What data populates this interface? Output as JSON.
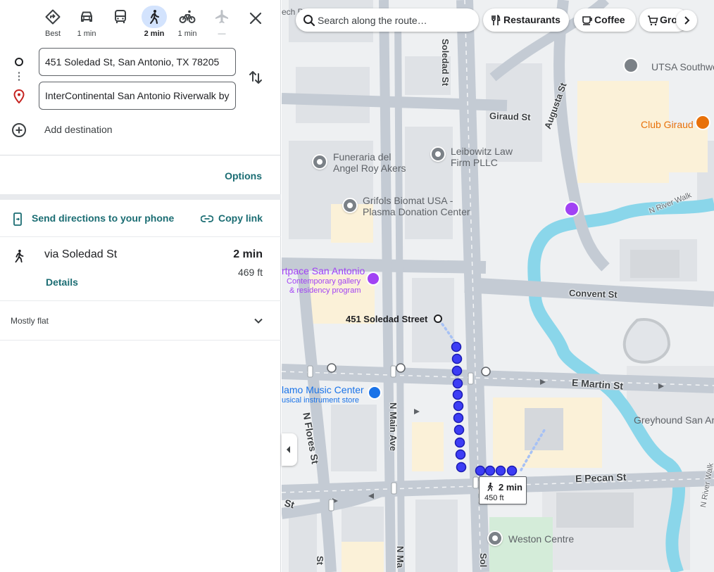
{
  "travel_modes": [
    {
      "id": "best",
      "label": "Best",
      "active": false,
      "disabled": false
    },
    {
      "id": "driving",
      "label": "1 min",
      "active": false,
      "disabled": false
    },
    {
      "id": "transit",
      "label": "",
      "active": false,
      "disabled": false
    },
    {
      "id": "walking",
      "label": "2 min",
      "active": true,
      "disabled": false
    },
    {
      "id": "cycling",
      "label": "1 min",
      "active": false,
      "disabled": false
    },
    {
      "id": "flight",
      "label": "—",
      "active": false,
      "disabled": true
    }
  ],
  "origin": {
    "value": "451 Soledad St, San Antonio, TX 78205"
  },
  "destination": {
    "value": "InterContinental San Antonio Riverwalk by IHG"
  },
  "add_destination_label": "Add destination",
  "options_label": "Options",
  "send_to_phone_label": "Send directions to your phone",
  "copy_link_label": "Copy link",
  "route": {
    "via": "via Soledad St",
    "duration": "2 min",
    "distance": "469 ft",
    "details_label": "Details",
    "elevation": "Mostly flat"
  },
  "map": {
    "search_placeholder": "Search along the route…",
    "chips": [
      {
        "id": "restaurants",
        "label": "Restaurants"
      },
      {
        "id": "coffee",
        "label": "Coffee"
      },
      {
        "id": "groceries",
        "label": "Gro"
      }
    ],
    "places": {
      "utsa": "UTSA Southwes",
      "club_giraud": "Club Giraud",
      "funeraria_1": "Funeraria del",
      "funeraria_2": "Angel Roy Akers",
      "leibowitz_1": "Leibowitz Law",
      "leibowitz_2": "Firm PLLC",
      "grifols_1": "Grifols Biomat USA -",
      "grifols_2": "Plasma Donation Center",
      "artpace_1": "rtpace San Antonio",
      "artpace_2": "Contemporary gallery",
      "artpace_3": "& residency program",
      "origin_label": "451 Soledad Street",
      "alamo_1": "lamo Music Center",
      "alamo_2": "usical instrument store",
      "greyhound": "Greyhound San An",
      "weston": "Weston Centre",
      "tech": "ech P"
    },
    "streets": {
      "soledad_top": "Soledad St",
      "soledad_bottom": "Sol",
      "giraud": "Giraud St",
      "augusta": "Augusta St",
      "n_river_walk": "N River Walk",
      "n_river_walk_2": "N River Walk",
      "convent": "Convent St",
      "e_martin": "E Martin St",
      "n_flores": "N Flores St",
      "n_main": "N Main Ave",
      "n_ma": "N Ma",
      "e_pecan": "E Pecan St",
      "st_left": "St",
      "st_bottom": "St"
    },
    "walk_badge": {
      "time": "2 min",
      "distance": "450 ft"
    }
  }
}
